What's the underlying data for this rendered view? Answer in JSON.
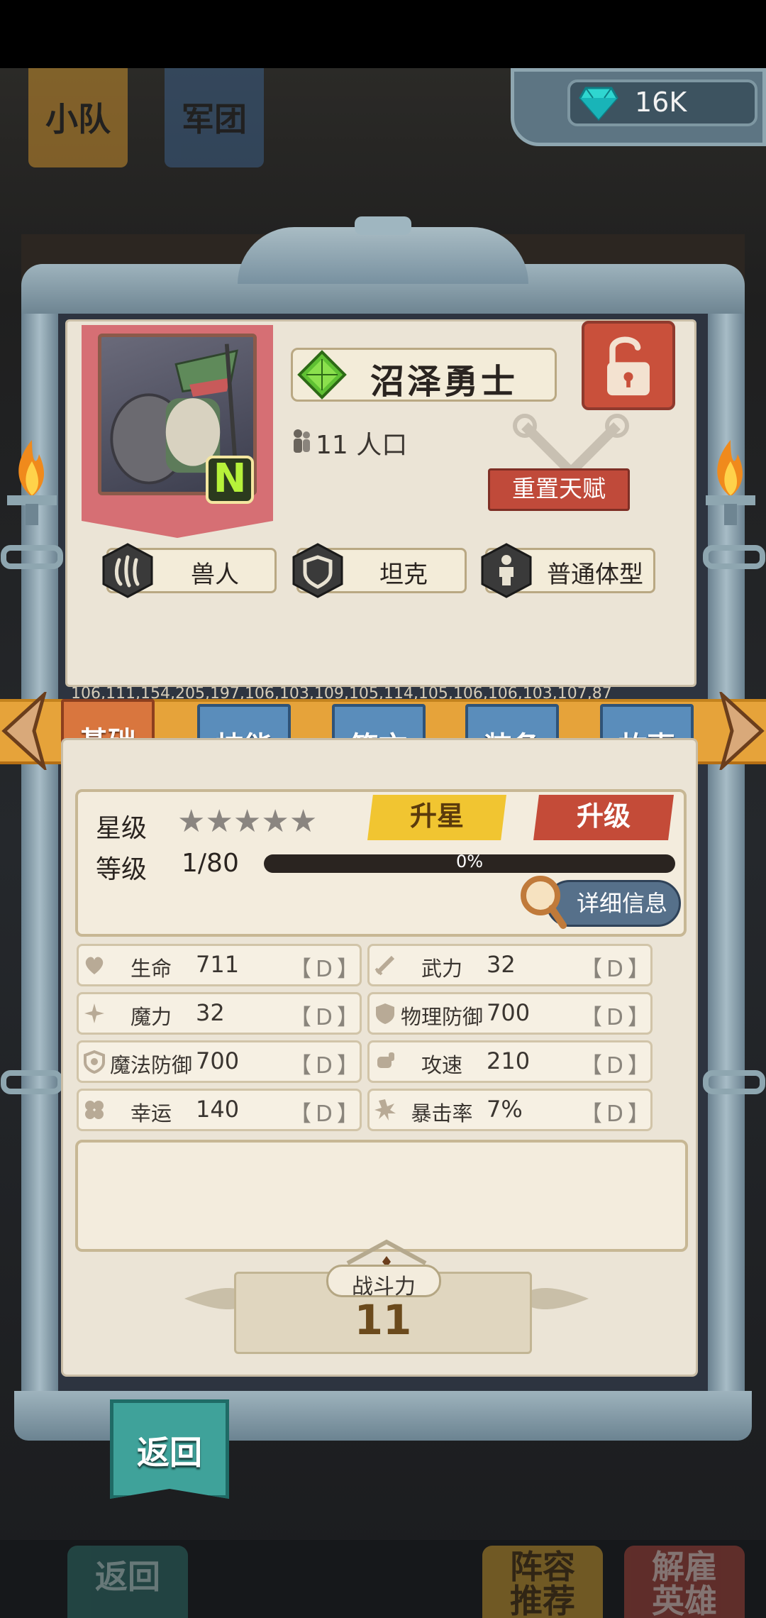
{
  "header": {
    "bg_tabs": [
      "小队",
      "军团"
    ],
    "diamonds": "16K"
  },
  "hero": {
    "name": "沼泽勇士",
    "rarity": "N",
    "population": "11 人口",
    "reset_talent": "重置天赋",
    "tags": [
      {
        "icon": "orc-claw-icon",
        "label": "兽人"
      },
      {
        "icon": "shield-icon",
        "label": "坦克"
      },
      {
        "icon": "person-icon",
        "label": "普通体型"
      }
    ]
  },
  "background_digits": "106,111,154,205,197,106,103,109,105,114,105,106,106,103,107,87",
  "tabs": [
    {
      "label": "基础",
      "active": true
    },
    {
      "label": "技能",
      "active": false
    },
    {
      "label": "符文",
      "active": false
    },
    {
      "label": "装备",
      "active": false
    },
    {
      "label": "故事",
      "active": false
    }
  ],
  "level_panel": {
    "star_label": "星级",
    "stars": 5,
    "stars_filled": 0,
    "level_label": "等级",
    "level_value": "1/80",
    "xp_percent": 0,
    "xp_text": "0%",
    "upstar": "升星",
    "uplevel": "升级",
    "detail": "详细信息"
  },
  "stats": [
    {
      "icon": "heart-icon",
      "name": "生命",
      "value": "711",
      "grade": "【D】"
    },
    {
      "icon": "sword-icon",
      "name": "武力",
      "value": "32",
      "grade": "【D】"
    },
    {
      "icon": "sparkle-icon",
      "name": "魔力",
      "value": "32",
      "grade": "【D】"
    },
    {
      "icon": "shield-icon",
      "name": "物理防御",
      "value": "700",
      "grade": "【D】"
    },
    {
      "icon": "magic-shield-icon",
      "name": "魔法防御",
      "value": "700",
      "grade": "【D】"
    },
    {
      "icon": "fist-icon",
      "name": "攻速",
      "value": "210",
      "grade": "【D】"
    },
    {
      "icon": "clover-icon",
      "name": "幸运",
      "value": "140",
      "grade": "【D】"
    },
    {
      "icon": "burst-icon",
      "name": "暴击率",
      "value": "7%",
      "grade": "【D】"
    }
  ],
  "power": {
    "label": "战斗力",
    "value": "11"
  },
  "back": "返回",
  "bottom_bar": {
    "back": "返回",
    "lineup_line1": "阵容",
    "lineup_line2": "推荐",
    "dismiss_line1": "解雇",
    "dismiss_line2": "英雄"
  },
  "colors": {
    "ribbon": "#e6a33a",
    "tab_blue": "#5a8dbb",
    "tab_active": "#d9763e",
    "upstar": "#f1c531",
    "uplevel": "#c44b38",
    "parchment": "#ebe4d6"
  }
}
